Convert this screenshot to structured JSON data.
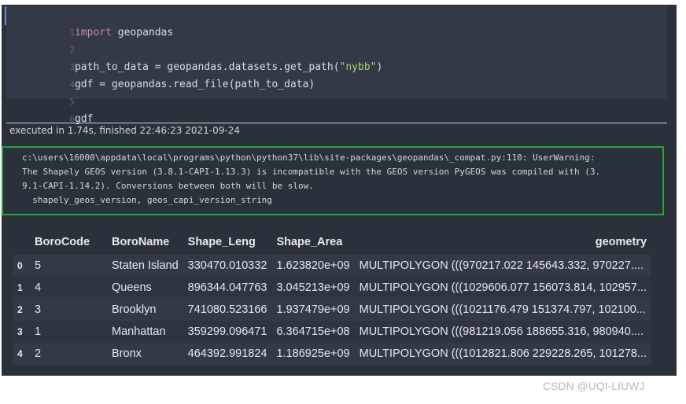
{
  "code_cell": {
    "lines": [
      {
        "num": "1",
        "kw": "import",
        "rest": " geopandas",
        "pre": "",
        "str": "",
        "post": ""
      },
      {
        "num": "2",
        "kw": "",
        "rest": "",
        "pre": "",
        "str": "",
        "post": ""
      },
      {
        "num": "3",
        "kw": "",
        "rest": "",
        "pre": "path_to_data = geopandas.datasets.get_path(",
        "str": "\"nybb\"",
        "post": ")"
      },
      {
        "num": "4",
        "kw": "",
        "rest": "",
        "pre": "gdf = geopandas.read_file(path_to_data)",
        "str": "",
        "post": ""
      },
      {
        "num": "5",
        "kw": "",
        "rest": "",
        "pre": "",
        "str": "",
        "post": ""
      },
      {
        "num": "6",
        "kw": "",
        "rest": "",
        "pre": "gdf",
        "str": "",
        "post": ""
      }
    ]
  },
  "execution_info": "executed in 1.74s, finished 22:46:23 2021-09-24",
  "stderr": [
    "c:\\users\\16000\\appdata\\local\\programs\\python\\python37\\lib\\site-packages\\geopandas\\_compat.py:110: UserWarning:",
    "The Shapely GEOS version (3.8.1-CAPI-1.13.3) is incompatible with the GEOS version PyGEOS was compiled with (3.",
    "9.1-CAPI-1.14.2). Conversions between both will be slow.",
    "  shapely_geos_version, geos_capi_version_string"
  ],
  "table": {
    "columns": [
      "BoroCode",
      "BoroName",
      "Shape_Leng",
      "Shape_Area",
      "geometry"
    ],
    "rows": [
      {
        "index": "0",
        "cells": [
          "5",
          "Staten Island",
          "330470.010332",
          "1.623820e+09",
          "MULTIPOLYGON (((970217.022 145643.332, 970227...."
        ]
      },
      {
        "index": "1",
        "cells": [
          "4",
          "Queens",
          "896344.047763",
          "3.045213e+09",
          "MULTIPOLYGON (((1029606.077 156073.814, 102957..."
        ]
      },
      {
        "index": "2",
        "cells": [
          "3",
          "Brooklyn",
          "741080.523166",
          "1.937479e+09",
          "MULTIPOLYGON (((1021176.479 151374.797, 102100..."
        ]
      },
      {
        "index": "3",
        "cells": [
          "1",
          "Manhattan",
          "359299.096471",
          "6.364715e+08",
          "MULTIPOLYGON (((981219.056 188655.316, 980940...."
        ]
      },
      {
        "index": "4",
        "cells": [
          "2",
          "Bronx",
          "464392.991824",
          "1.186925e+09",
          "MULTIPOLYGON (((1012821.806 229228.265, 101278..."
        ]
      }
    ]
  },
  "watermark": "CSDN @UQI-LIUWJ",
  "colors": {
    "notebook_bg": "#2b313b",
    "code_bg": "#343a45",
    "keyword": "#c586c0",
    "string": "#a6d076",
    "stderr_border": "#2aa23a"
  }
}
